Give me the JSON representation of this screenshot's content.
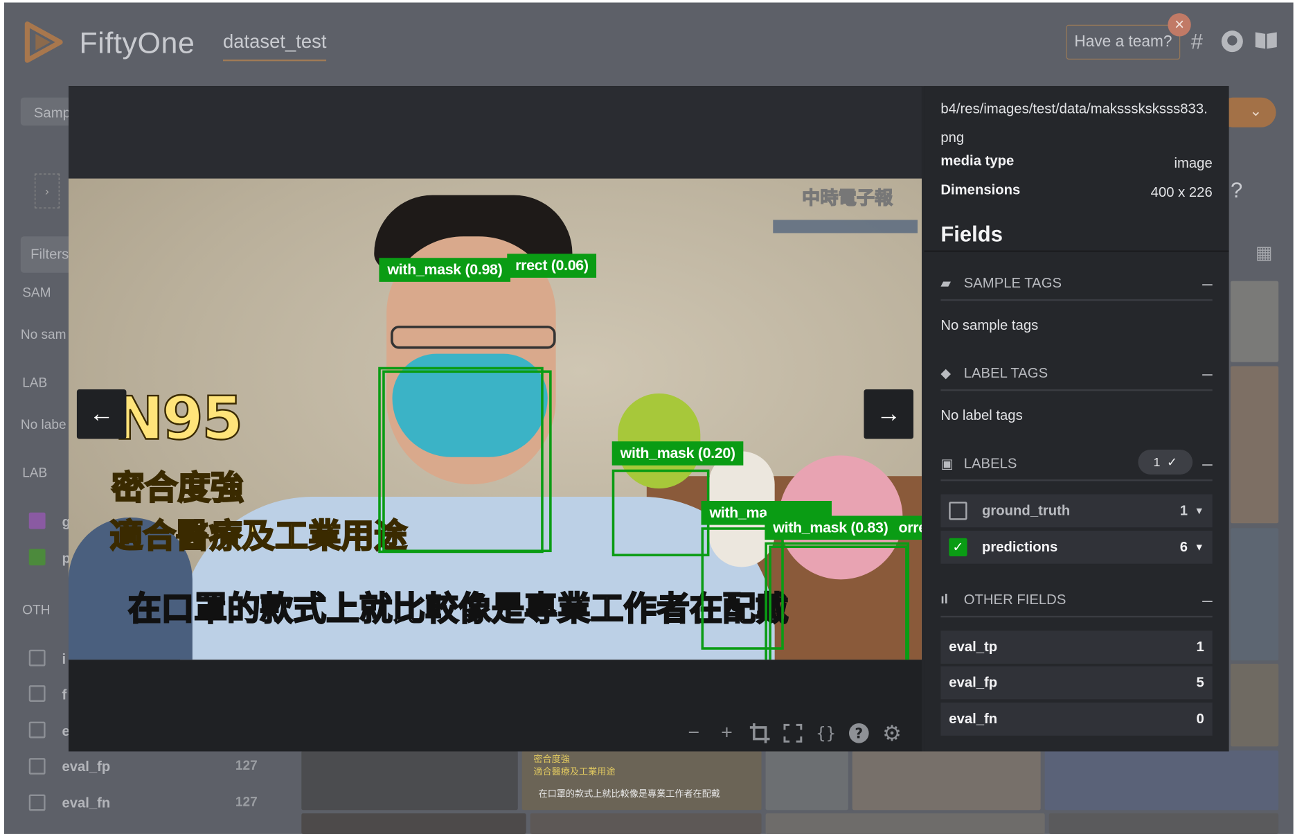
{
  "header": {
    "brand": "FiftyOne",
    "dataset_name": "dataset_test",
    "team_button": "Have a team?",
    "close_icon": "×"
  },
  "background": {
    "samples_tab": "Samp",
    "filters_label": "Filters",
    "sample_tags_label": "SAM",
    "no_sample_tags": "No sam",
    "label_tags_label": "LAB",
    "no_label_tags": "No labe",
    "labels_label": "LAB",
    "ground_truth_short": "g",
    "predictions_short": "p",
    "other_label": "OTH",
    "other_rows": [
      {
        "name": "i"
      },
      {
        "name": "f"
      },
      {
        "name": "e"
      }
    ],
    "eval_fp": {
      "name": "eval_fp",
      "count": "127"
    },
    "eval_fn": {
      "name": "eval_fn",
      "count": "127"
    },
    "thumb_caption_1": "密合度強",
    "thumb_caption_2": "適合醫療及工業用途",
    "thumb_caption_3": "在口罩的款式上就比較像是專業工作者在配戴"
  },
  "image": {
    "subtitle_n95": "N95",
    "subtitle_line1": "密合度強",
    "subtitle_line2": "適合醫療及工業用途",
    "subtitle_bottom": "在口罩的款式上就比較像是專業工作者在配戴",
    "watermark": "中時電子報",
    "detections": [
      {
        "label": "with_mask (0.98)"
      },
      {
        "label": "rrect (0.06)"
      },
      {
        "label": "with_mask (0.20)"
      },
      {
        "label": "with_ma"
      },
      {
        "label": "with_mask (0.83)"
      },
      {
        "label": "orre"
      }
    ]
  },
  "panel": {
    "filepath": "b4/res/images/test/data/maksssksksss833.png",
    "media_type_key": "media type",
    "media_type_value": "image",
    "dimensions_key": "Dimensions",
    "dimensions_value": "400 x 226",
    "fields_title": "Fields",
    "sample_tags_header": "SAMPLE TAGS",
    "no_sample_tags": "No sample tags",
    "label_tags_header": "LABEL TAGS",
    "no_label_tags": "No label tags",
    "labels_header": "LABELS",
    "labels_badge": "1",
    "labels": [
      {
        "name": "ground_truth",
        "count": "1",
        "checked": false
      },
      {
        "name": "predictions",
        "count": "6",
        "checked": true
      }
    ],
    "other_fields_header": "OTHER FIELDS",
    "other_fields": [
      {
        "name": "eval_tp",
        "value": "1"
      },
      {
        "name": "eval_fp",
        "value": "5"
      },
      {
        "name": "eval_fn",
        "value": "0"
      }
    ]
  },
  "colors": {
    "accent_green": "#0a9c14",
    "brand_orange": "#c97a2e"
  }
}
